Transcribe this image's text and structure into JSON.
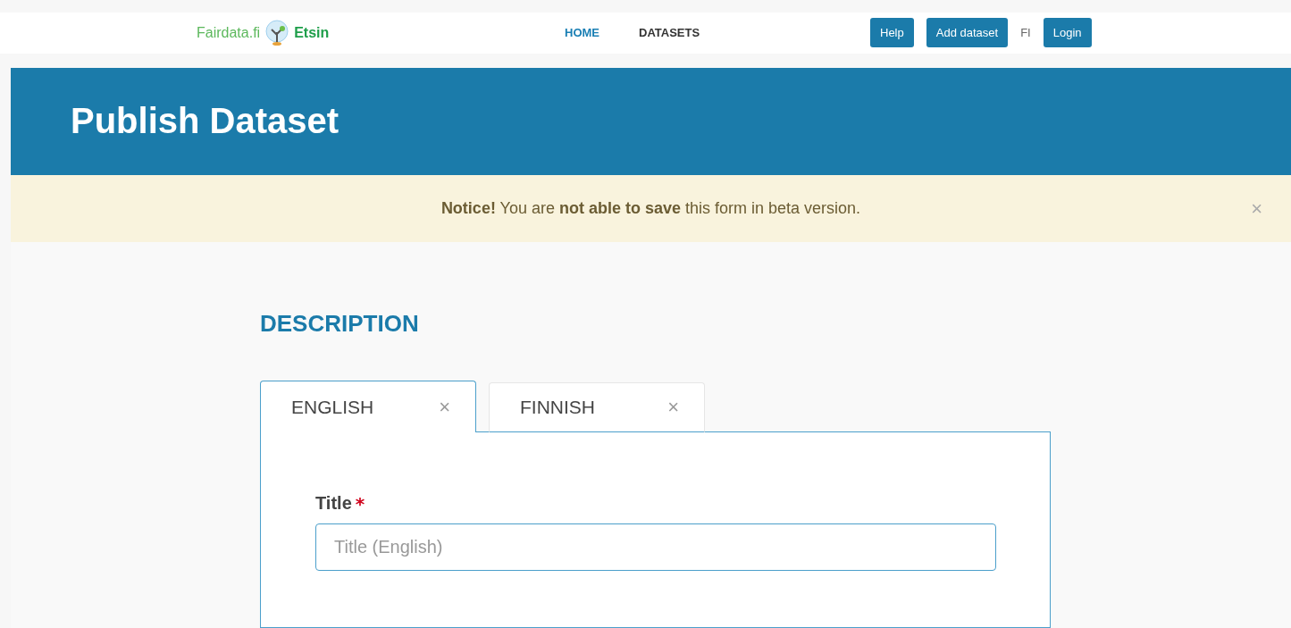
{
  "header": {
    "logo": {
      "brand": "Fairdata.fi",
      "product": "Etsin"
    },
    "nav": [
      {
        "label": "HOME",
        "selected": true
      },
      {
        "label": "DATASETS",
        "selected": false
      }
    ],
    "buttons": [
      {
        "kind": "button",
        "label": "Help"
      },
      {
        "kind": "button",
        "label": "Add dataset"
      },
      {
        "kind": "link",
        "label": "FI"
      },
      {
        "kind": "button",
        "label": "Login"
      }
    ]
  },
  "banner": {
    "title": "Publish Dataset"
  },
  "notice": {
    "text": "**Notice!** You are **not able to save** this form in beta version.",
    "close": "×"
  },
  "section": {
    "heading": "DESCRIPTION",
    "tabs": [
      {
        "label": "ENGLISH",
        "close": "×",
        "selected": true
      },
      {
        "label": "FINNISH",
        "close": "×",
        "selected": false
      }
    ],
    "field": {
      "label": "Title",
      "required_mark": "*",
      "placeholder": "Title (English)"
    }
  }
}
